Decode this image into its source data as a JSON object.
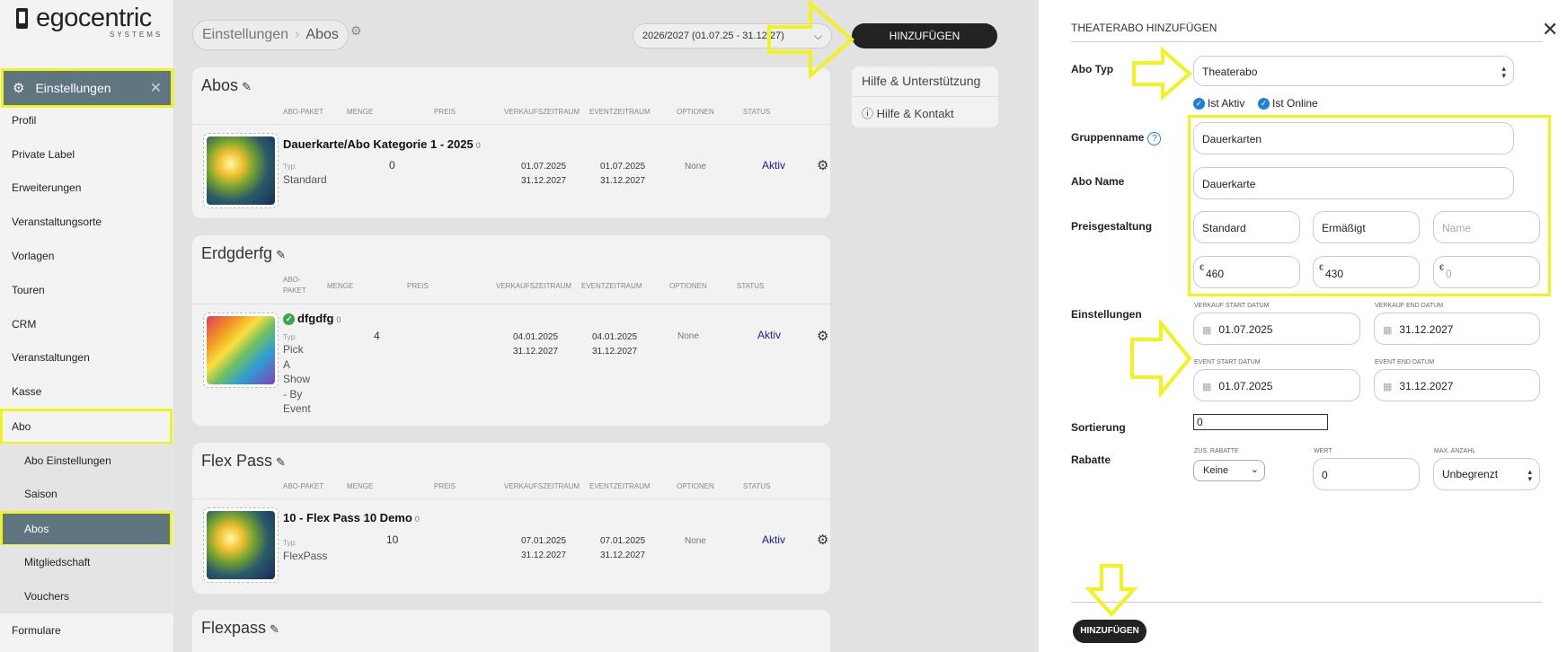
{
  "brand": {
    "name": "egocentric",
    "tagline": "SYSTEMS"
  },
  "sidebar": {
    "section": "Einstellungen",
    "items": [
      {
        "label": "Profil"
      },
      {
        "label": "Private Label"
      },
      {
        "label": "Erweiterungen"
      },
      {
        "label": "Veranstaltungsorte"
      },
      {
        "label": "Vorlagen"
      },
      {
        "label": "Touren"
      },
      {
        "label": "CRM"
      },
      {
        "label": "Veranstaltungen"
      },
      {
        "label": "Kasse"
      },
      {
        "label": "Abo"
      },
      {
        "label": "Abo Einstellungen"
      },
      {
        "label": "Saison"
      },
      {
        "label": "Abos"
      },
      {
        "label": "Mitgliedschaft"
      },
      {
        "label": "Vouchers"
      },
      {
        "label": "Formulare"
      }
    ]
  },
  "breadcrumb": [
    "Einstellungen",
    "Abos"
  ],
  "season": "2026/2027 (01.07.25 - 31.12.27)",
  "toolbar": {
    "add_label": "HINZUFÜGEN"
  },
  "help": {
    "title": "Hilfe & Unterstützung",
    "contact": "Hilfe & Kontakt"
  },
  "columns": [
    "ABO-PAKET",
    "MENGE",
    "PREIS",
    "VERKAUFSZEITRAUM",
    "EVENTZEITRAUM",
    "OPTIONEN",
    "STATUS"
  ],
  "columns_wrapped": {
    "abo_paket_1": "ABO-",
    "abo_paket_2": "PAKET"
  },
  "type_label": "Typ:",
  "groups": [
    {
      "title": "Abos",
      "item": {
        "name": "Dauerkarte/Abo Kategorie 1 - 2025",
        "count": "0",
        "type": "Standard",
        "qty": "0",
        "sale_start": "01.07.2025",
        "sale_end": "31.12.2027",
        "event_start": "01.07.2025",
        "event_end": "31.12.2027",
        "options": "None",
        "status": "Aktiv"
      }
    },
    {
      "title": "Erdgderfg",
      "item": {
        "name": "dfgdfg",
        "count": "0",
        "type": [
          "Pick",
          "A",
          "Show",
          "- By",
          "Event"
        ],
        "qty": "4",
        "sale_start": "04.01.2025",
        "sale_end": "31.12.2027",
        "event_start": "04.01.2025",
        "event_end": "31.12.2027",
        "options": "None",
        "status": "Aktiv"
      }
    },
    {
      "title": "Flex Pass",
      "item": {
        "name": "10 - Flex Pass 10 Demo",
        "count": "0",
        "type": "FlexPass",
        "qty": "10",
        "sale_start": "07.01.2025",
        "sale_end": "31.12.2027",
        "event_start": "07.01.2025",
        "event_end": "31.12.2027",
        "options": "None",
        "status": "Aktiv"
      }
    },
    {
      "title": "Flexpass"
    }
  ],
  "panel": {
    "title": "THEATERABO HINZUFÜGEN",
    "abo_typ": {
      "label": "Abo Typ",
      "value": "Theaterabo"
    },
    "checks": {
      "aktiv": "Ist Aktiv",
      "online": "Ist Online"
    },
    "gruppenname": {
      "label": "Gruppenname",
      "value": "Dauerkarten",
      "help": "?"
    },
    "abo_name": {
      "label": "Abo Name",
      "value": "Dauerkarte"
    },
    "preis": {
      "label": "Preisgestaltung",
      "names": [
        "Standard",
        "Ermäßigt",
        ""
      ],
      "name_placeholder": "Name",
      "currency": "€",
      "prices": [
        "460",
        "430",
        ""
      ],
      "price_placeholder": "0"
    },
    "einstellungen": {
      "label": "Einstellungen",
      "verkauf_start_label": "VERKAUF START DATUM",
      "verkauf_start": "01.07.2025",
      "verkauf_end_label": "VERKAUF END DATUM",
      "verkauf_end": "31.12.2027",
      "event_start_label": "EVENT START DATUM",
      "event_start": "01.07.2025",
      "event_end_label": "EVENT END DATUM",
      "event_end": "31.12.2027"
    },
    "sortierung": {
      "label": "Sortierung",
      "value": "0"
    },
    "rabatte": {
      "label": "Rabatte",
      "zus_label": "ZUS. RABATTE",
      "zus_value": "Keine",
      "wert_label": "WERT",
      "wert_value": "0",
      "max_label": "MAX. ANZAHL",
      "max_value": "Unbegrenzt"
    },
    "submit": "HINZUFÜGEN"
  },
  "colors": {
    "accent_dark": "#222222",
    "nav_active": "#5f7580",
    "highlight": "#f2f21f",
    "status": "#1a1aa0",
    "check": "#1e7fe0"
  }
}
